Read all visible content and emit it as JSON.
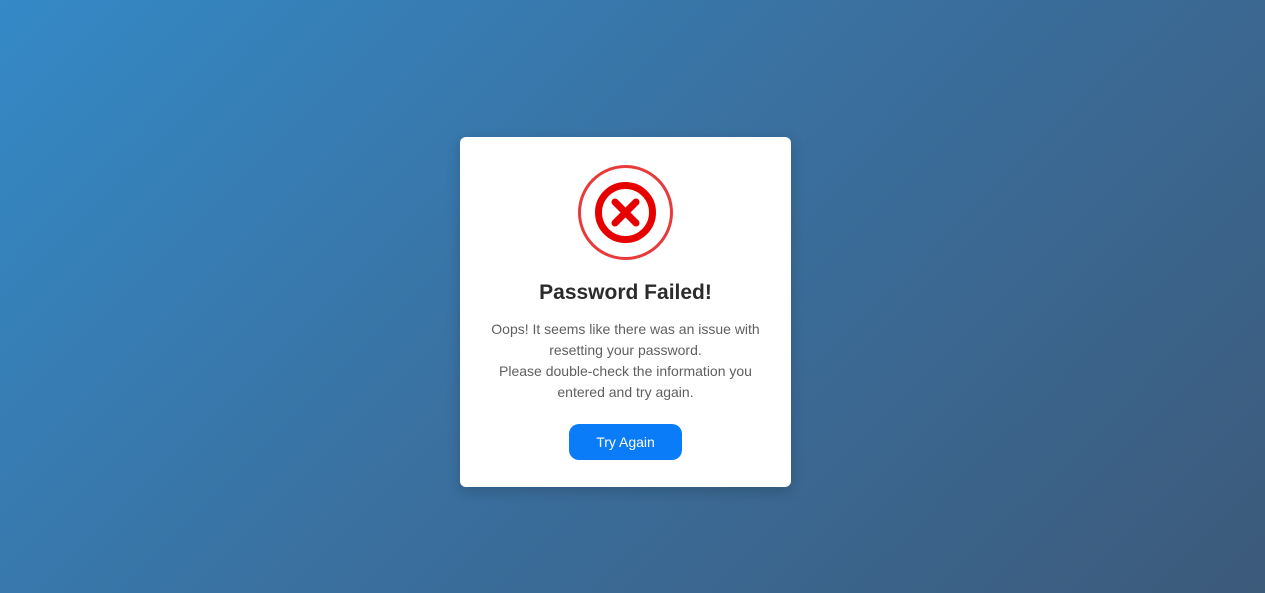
{
  "dialog": {
    "icon": "error-x-circle-icon",
    "title": "Password Failed!",
    "message_lines": [
      "Oops! It seems like there was an issue with resetting your password.",
      "Please double-check the information you entered and try again."
    ],
    "button_label": "Try Again"
  },
  "colors": {
    "error_red": "#e60000",
    "button_blue": "#0a7cf7"
  }
}
